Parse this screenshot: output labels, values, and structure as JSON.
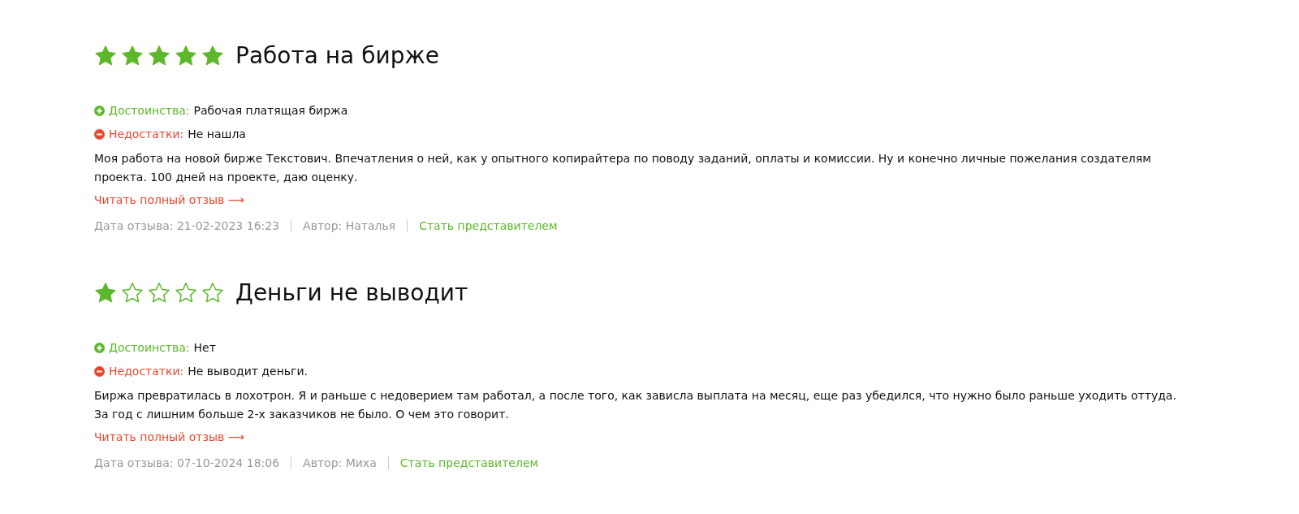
{
  "reviews": [
    {
      "stars": 5,
      "title": "Работа на бирже",
      "pros_label": "Достоинства:",
      "pros": "Рабочая платящая биржа",
      "cons_label": "Недостатки:",
      "cons": "Не нашла",
      "text": "Моя работа на новой бирже Текстович. Впечатления о ней, как у опытного копирайтера по поводу заданий, оплаты и комиссии. Ну и конечно личные пожелания создателям проекта. 100 дней на проекте, даю оценку.",
      "read_more": "Читать полный отзыв ⟶",
      "date": "Дата отзыва: 21-02-2023 16:23",
      "author": "Автор: Наталья",
      "represent": "Стать представителем"
    },
    {
      "stars": 1,
      "title": "Деньги не выводит",
      "pros_label": "Достоинства:",
      "pros": "Нет",
      "cons_label": "Недостатки:",
      "cons": "Не выводит деньги.",
      "text": "Биржа превратилась в лохотрон. Я и раньше с недоверием там работал, а после того, как зависла выплата на месяц, еще раз убедился, что нужно было раньше уходить оттуда. За год с лишним больше 2-х заказчиков не было. О чем это говорит.",
      "read_more": "Читать полный отзыв ⟶",
      "date": "Дата отзыва: 07-10-2024 18:06",
      "author": "Автор: Миха",
      "represent": "Стать представителем"
    }
  ]
}
